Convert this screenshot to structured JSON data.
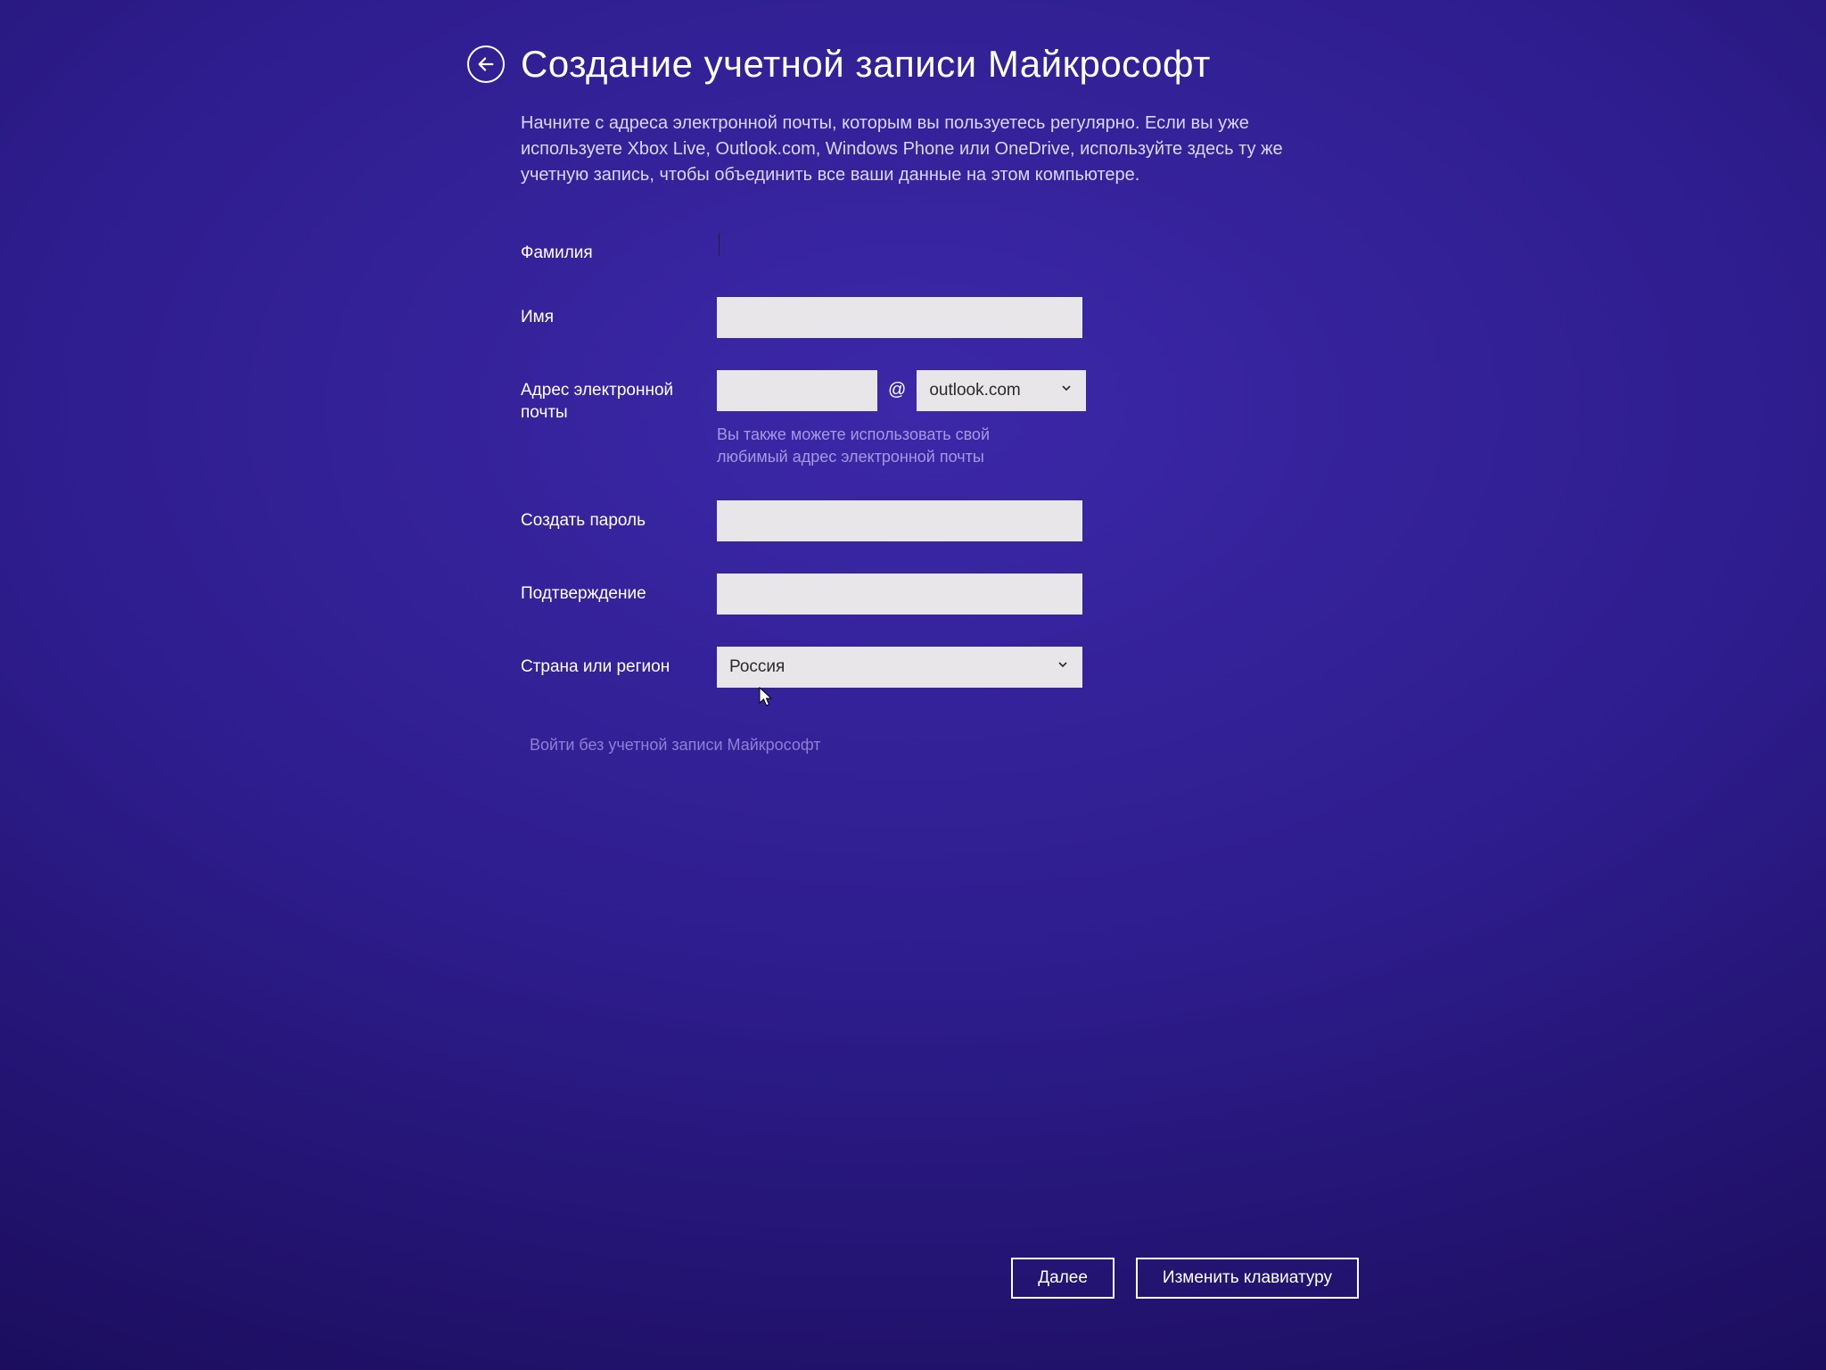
{
  "header": {
    "title": "Создание учетной записи Майкрософт"
  },
  "instructions": "Начните с адреса электронной почты, которым вы пользуетесь регулярно. Если вы уже используете Xbox Live, Outlook.com, Windows Phone или OneDrive, используйте здесь ту же учетную запись, чтобы объединить все ваши данные на этом компьютере.",
  "fields": {
    "lastname": {
      "label": "Фамилия",
      "value": ""
    },
    "firstname": {
      "label": "Имя",
      "value": ""
    },
    "email": {
      "label": "Адрес электронной почты",
      "user_value": "",
      "at": "@",
      "domain_selected": "outlook.com",
      "hint": "Вы также можете использовать свой любимый адрес электронной почты"
    },
    "password": {
      "label": "Создать пароль",
      "value": ""
    },
    "confirm": {
      "label": "Подтверждение",
      "value": ""
    },
    "country": {
      "label": "Страна или регион",
      "selected": "Россия"
    }
  },
  "links": {
    "signin_without": "Войти без учетной записи Майкрософт"
  },
  "buttons": {
    "next": "Далее",
    "change_keyboard": "Изменить клавиатуру"
  }
}
